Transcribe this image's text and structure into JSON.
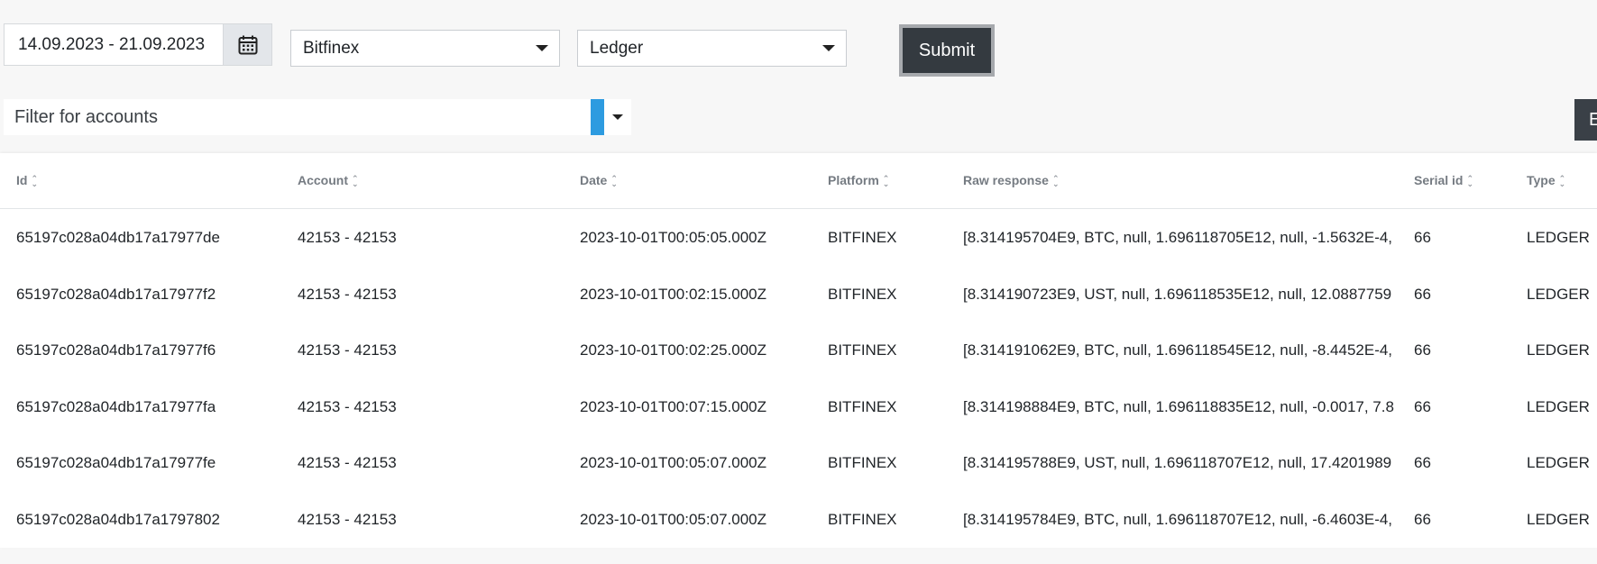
{
  "date_range": {
    "value": "14.09.2023 - 21.09.2023"
  },
  "exchange_select": {
    "selected": "Bitfinex"
  },
  "type_select": {
    "selected": "Ledger"
  },
  "submit_label": "Submit",
  "filter": {
    "placeholder": "Filter for accounts"
  },
  "edge_button_label": "E",
  "table": {
    "columns": [
      "Id",
      "Account",
      "Date",
      "Platform",
      "Raw response",
      "Serial id",
      "Type"
    ],
    "rows": [
      [
        "65197c028a04db17a17977de",
        "42153 - 42153",
        "2023-10-01T00:05:05.000Z",
        "BITFINEX",
        "[8.314195704E9, BTC, null, 1.696118705E12, null, -1.5632E-4,",
        "66",
        "LEDGER"
      ],
      [
        "65197c028a04db17a17977f2",
        "42153 - 42153",
        "2023-10-01T00:02:15.000Z",
        "BITFINEX",
        "[8.314190723E9, UST, null, 1.696118535E12, null, 12.0887759",
        "66",
        "LEDGER"
      ],
      [
        "65197c028a04db17a17977f6",
        "42153 - 42153",
        "2023-10-01T00:02:25.000Z",
        "BITFINEX",
        "[8.314191062E9, BTC, null, 1.696118545E12, null, -8.4452E-4,",
        "66",
        "LEDGER"
      ],
      [
        "65197c028a04db17a17977fa",
        "42153 - 42153",
        "2023-10-01T00:07:15.000Z",
        "BITFINEX",
        "[8.314198884E9, BTC, null, 1.696118835E12, null, -0.0017, 7.8",
        "66",
        "LEDGER"
      ],
      [
        "65197c028a04db17a17977fe",
        "42153 - 42153",
        "2023-10-01T00:05:07.000Z",
        "BITFINEX",
        "[8.314195788E9, UST, null, 1.696118707E12, null, 17.4201989",
        "66",
        "LEDGER"
      ],
      [
        "65197c028a04db17a1797802",
        "42153 - 42153",
        "2023-10-01T00:05:07.000Z",
        "BITFINEX",
        "[8.314195784E9, BTC, null, 1.696118707E12, null, -6.4603E-4,",
        "66",
        "LEDGER"
      ]
    ]
  },
  "colors": {
    "accent": "#2d9be0",
    "button_dark": "#343a40",
    "header_text": "#757b82",
    "page_bg": "#f7f7f7"
  }
}
